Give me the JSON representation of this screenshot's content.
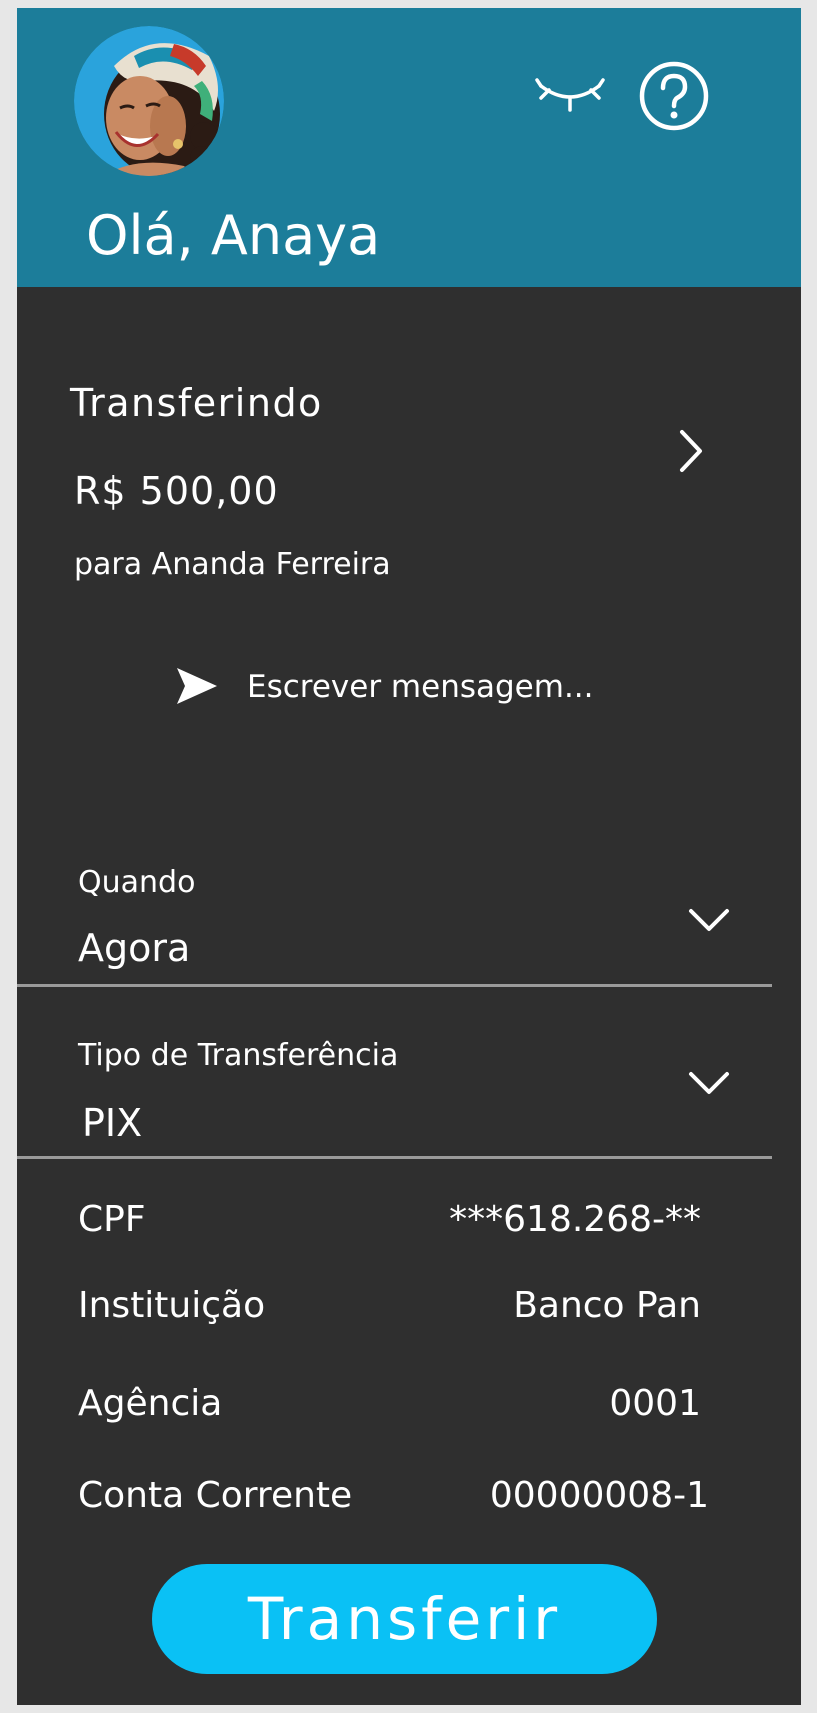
{
  "header": {
    "greeting": "Olá, Anaya",
    "avatar_icon": "user-avatar",
    "hide_balance_icon": "eye-closed-icon",
    "help_icon": "question-circle-icon",
    "background_color": "#1c7d9a"
  },
  "transfer_summary": {
    "title": "Transferindo",
    "amount": "R$ 500,00",
    "recipient": "para Ananda Ferreira"
  },
  "message": {
    "placeholder": "Escrever mensagem...",
    "icon": "send-icon"
  },
  "when_field": {
    "label": "Quando",
    "value": "Agora"
  },
  "type_field": {
    "label": "Tipo de Transferência",
    "value": "PIX"
  },
  "details": [
    {
      "label": "CPF",
      "value": "***618.268-**"
    },
    {
      "label": "Instituição",
      "value": "Banco Pan"
    },
    {
      "label": "Agência",
      "value": "0001"
    },
    {
      "label": "Conta Corrente",
      "value": "00000008-1"
    }
  ],
  "action": {
    "transfer_label": "Transferir",
    "button_color": "#0ac1f5"
  }
}
